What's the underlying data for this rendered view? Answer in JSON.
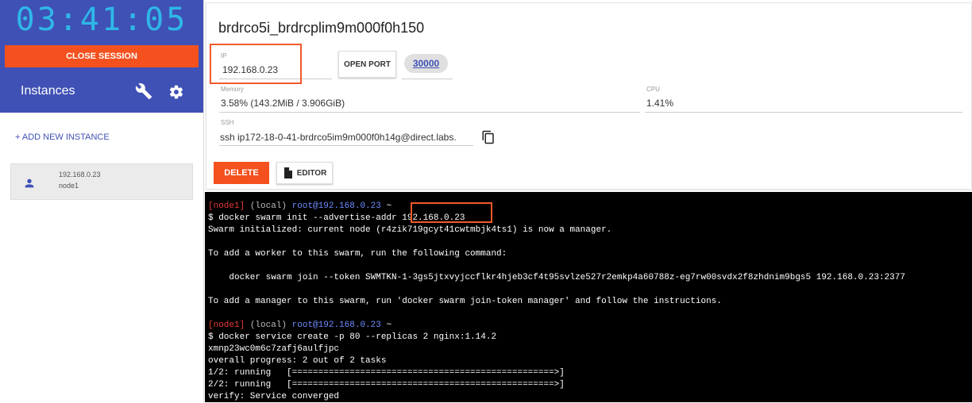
{
  "clock": "03:41:05",
  "close_session": "CLOSE SESSION",
  "sidebar": {
    "title": "Instances",
    "add_instance": "+ ADD NEW INSTANCE",
    "instance_ip": "192.168.0.23",
    "instance_name": "node1"
  },
  "instance": {
    "hostname": "brdrco5i_brdrcplim9m000f0h150",
    "ip_label": "IP",
    "ip": "192.168.0.23",
    "open_port": "OPEN PORT",
    "port": "30000",
    "memory_label": "Memory",
    "memory": "3.58% (143.2MiB / 3.906GiB)",
    "cpu_label": "CPU",
    "cpu": "1.41%",
    "ssh_label": "SSH",
    "ssh": "ssh ip172-18-0-41-brdrco5im9m000f0h14g@direct.labs.",
    "delete": "DELETE",
    "editor": "EDITOR"
  },
  "terminal": {
    "prompt1_node": "[node1]",
    "prompt1_local": " (local) ",
    "prompt1_user": "root@192.168.0.23",
    "prompt1_tail": " ~",
    "cmd1": "$ docker swarm init --advertise-addr 192.168.0.23",
    "out1": "Swarm initialized: current node (r4zik719gcyt41cwtmbjk4ts1) is now a manager.",
    "out2": "To add a worker to this swarm, run the following command:",
    "out3": "    docker swarm join --token SWMTKN-1-3gs5jtxvyjccflkr4hjeb3cf4t95svlze527r2emkp4a60788z-eg7rw00svdx2f8zhdnim9bgs5 192.168.0.23:2377",
    "out4": "To add a manager to this swarm, run 'docker swarm join-token manager' and follow the instructions.",
    "prompt2_node": "[node1]",
    "prompt2_local": " (local) ",
    "prompt2_user": "root@192.168.0.23",
    "prompt2_tail": " ~",
    "cmd2": "$ docker service create -p 80 --replicas 2 nginx:1.14.2",
    "out5": "xmnp23wc0m6c7zafj6aulfjpc",
    "out6": "overall progress: 2 out of 2 tasks",
    "out7": "1/2: running   [==================================================>]",
    "out8": "2/2: running   [==================================================>]",
    "out9": "verify: Service converged"
  },
  "colors": {
    "sidebar_blue": "#3f51b5",
    "accent_orange": "#f4511e",
    "clock_cyan": "#2fb7e8"
  }
}
